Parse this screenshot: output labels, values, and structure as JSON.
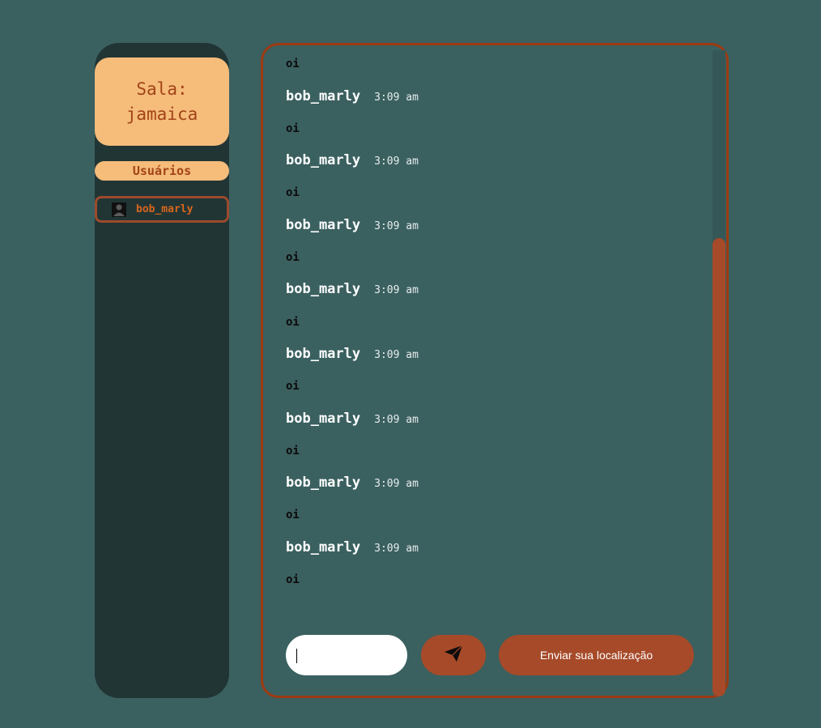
{
  "sidebar": {
    "room_label": "Sala:",
    "room_name": "jamaica",
    "users_header": "Usuários",
    "users": [
      {
        "name": "bob_marly",
        "icon": "user-avatar-icon"
      }
    ]
  },
  "chat": {
    "messages": [
      {
        "text": "oi"
      },
      {
        "author": "bob_marly",
        "time": "3:09 am",
        "text": "oi"
      },
      {
        "author": "bob_marly",
        "time": "3:09 am",
        "text": "oi"
      },
      {
        "author": "bob_marly",
        "time": "3:09 am",
        "text": "oi"
      },
      {
        "author": "bob_marly",
        "time": "3:09 am",
        "text": "oi"
      },
      {
        "author": "bob_marly",
        "time": "3:09 am",
        "text": "oi"
      },
      {
        "author": "bob_marly",
        "time": "3:09 am",
        "text": "oi"
      },
      {
        "author": "bob_marly",
        "time": "3:09 am",
        "text": "oi"
      },
      {
        "author": "bob_marly",
        "time": "3:09 am",
        "text": "oi"
      }
    ]
  },
  "composer": {
    "input_value": "",
    "input_placeholder": "",
    "send_icon": "paper-plane-icon",
    "location_label": "Enviar sua localização"
  },
  "colors": {
    "background": "#3b6060",
    "sidebar": "#213535",
    "accent_light": "#f5bc7a",
    "accent_dark": "#a64a29",
    "room_text": "#a24318",
    "user_name": "#d8661c"
  }
}
